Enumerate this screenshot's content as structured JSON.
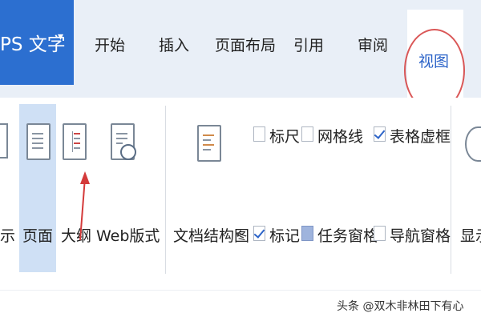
{
  "app": {
    "label": "PS 文字",
    "menu_arrow": "▾"
  },
  "tabs": [
    {
      "label": "开始"
    },
    {
      "label": "插入"
    },
    {
      "label": "页面布局"
    },
    {
      "label": "引用"
    },
    {
      "label": "审阅"
    },
    {
      "label": "视图",
      "active": true
    }
  ],
  "ribbon": {
    "left_partial_label": "示",
    "views": [
      {
        "label": "页面",
        "icon": "page-view-icon",
        "active": true
      },
      {
        "label": "大纲",
        "icon": "outline-view-icon"
      },
      {
        "label": "Web版式",
        "icon": "web-layout-icon"
      }
    ],
    "doc_map": {
      "label": "文档结构图",
      "icon": "document-map-icon",
      "arrow": "▾"
    },
    "checkboxes": [
      {
        "label": "标尺",
        "state": "unchecked"
      },
      {
        "label": "网格线",
        "state": "unchecked"
      },
      {
        "label": "表格虚框",
        "state": "checked"
      },
      {
        "label": "标记",
        "state": "checked"
      },
      {
        "label": "任务窗格",
        "state": "filled"
      },
      {
        "label": "导航窗格",
        "state": "unchecked"
      }
    ],
    "right_partial_label": "显示"
  },
  "watermark": "头条 @双木非林田下有心",
  "colors": {
    "app_blue": "#2c6fd0",
    "active_tab_text": "#2b63c8",
    "annotation_red": "#d43a3a"
  }
}
